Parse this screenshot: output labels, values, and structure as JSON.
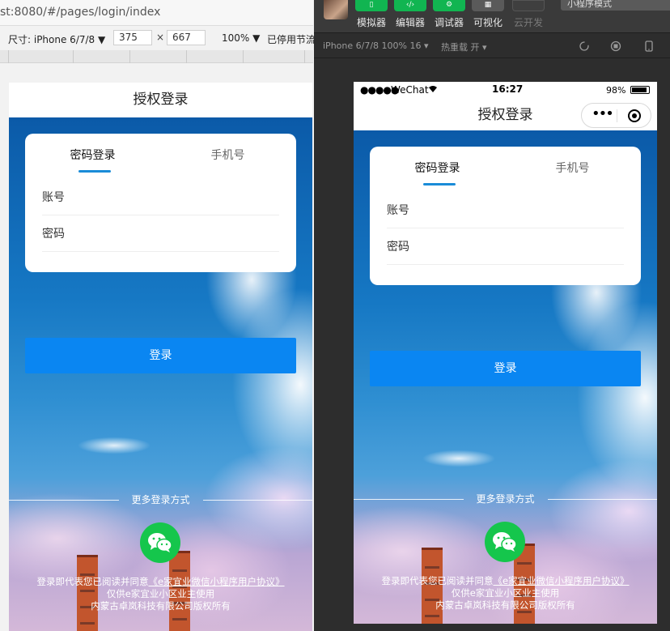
{
  "browser": {
    "url": "st:8080/#/pages/login/index",
    "device_select": "尺寸: iPhone 6/7/8 ▼",
    "width_value": "375",
    "height_value": "667",
    "times": "×",
    "zoom_select": "100% ▼",
    "throttle_select": "已停用节流"
  },
  "devtools": {
    "tools": [
      {
        "label": "模拟器",
        "icon": "phone-icon"
      },
      {
        "label": "编辑器",
        "icon": "code-icon"
      },
      {
        "label": "调试器",
        "icon": "debug-icon"
      },
      {
        "label": "可视化",
        "icon": "layout-icon"
      },
      {
        "label": "云开发",
        "icon": "cloud-icon"
      }
    ],
    "mode_select": "小程序模式",
    "sim_device": "iPhone 6/7/8 100% 16 ▾",
    "hot_reload": "热重载 开 ▾"
  },
  "statusbar": {
    "signal": "●●●●●",
    "carrier": "WeChat",
    "time": "16:27",
    "battery": "98%"
  },
  "login": {
    "nav_title": "授权登录",
    "tab_password": "密码登录",
    "tab_phone": "手机号",
    "account_label": "账号",
    "password_label": "密码",
    "login_button": "登录",
    "more_methods": "更多登录方式",
    "agreement_prefix": "登录即代表您已阅读并同意",
    "agreement_link": "《e家宜业微信小程序用户协议》",
    "agreement_line2": "仅供e家宜业小区业主使用",
    "copyright": "内蒙古卓岚科技有限公司版权所有"
  },
  "colors": {
    "accent": "#0a86f2",
    "tab_indicator": "#1a8cd8",
    "wechat_green": "#15c64c",
    "toolbar_green": "#11b551"
  }
}
